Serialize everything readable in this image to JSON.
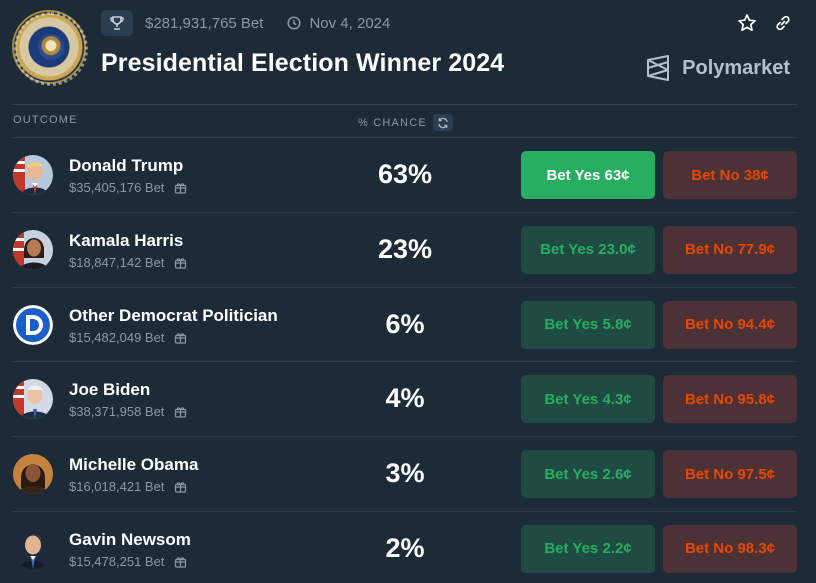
{
  "header": {
    "total_bet": "$281,931,765 Bet",
    "date": "Nov 4, 2024",
    "title": "Presidential Election Winner 2024",
    "brand": "Polymarket"
  },
  "columns": {
    "outcome": "OUTCOME",
    "chance": "% CHANCE"
  },
  "colors": {
    "background": "#1d2b39",
    "yes_green": "#27ae60",
    "no_red": "#e64800",
    "muted_text": "#8a97a6"
  },
  "outcomes": [
    {
      "name": "Donald Trump",
      "volume": "$35,405,176 Bet",
      "chance": "63%",
      "yes": "Bet Yes 63¢",
      "no": "Bet No 38¢"
    },
    {
      "name": "Kamala Harris",
      "volume": "$18,847,142 Bet",
      "chance": "23%",
      "yes": "Bet Yes 23.0¢",
      "no": "Bet No 77.9¢"
    },
    {
      "name": "Other Democrat Politician",
      "volume": "$15,482,049 Bet",
      "chance": "6%",
      "yes": "Bet Yes 5.8¢",
      "no": "Bet No 94.4¢"
    },
    {
      "name": "Joe Biden",
      "volume": "$38,371,958 Bet",
      "chance": "4%",
      "yes": "Bet Yes 4.3¢",
      "no": "Bet No 95.8¢"
    },
    {
      "name": "Michelle Obama",
      "volume": "$16,018,421 Bet",
      "chance": "3%",
      "yes": "Bet Yes 2.6¢",
      "no": "Bet No 97.5¢"
    },
    {
      "name": "Gavin Newsom",
      "volume": "$15,478,251 Bet",
      "chance": "2%",
      "yes": "Bet Yes 2.2¢",
      "no": "Bet No 98.3¢"
    }
  ]
}
